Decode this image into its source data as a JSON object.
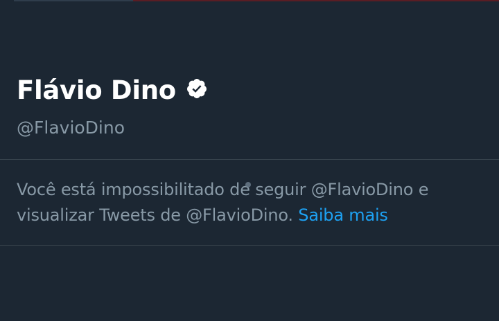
{
  "profile": {
    "display_name": "Flávio Dino",
    "handle": "@FlavioDino",
    "verified": true,
    "verified_icon": "verified-badge-icon"
  },
  "notice": {
    "line1": "Você está impossibilitado de seguir @FlavioDino e",
    "line2": "visualizar Tweets de @FlavioDino.",
    "learn_more_label": "Saiba mais"
  },
  "colors": {
    "background": "#1c2733",
    "name": "#ffffff",
    "secondary_text": "#8899a6",
    "link": "#1da1f2",
    "divider": "#38444d"
  }
}
